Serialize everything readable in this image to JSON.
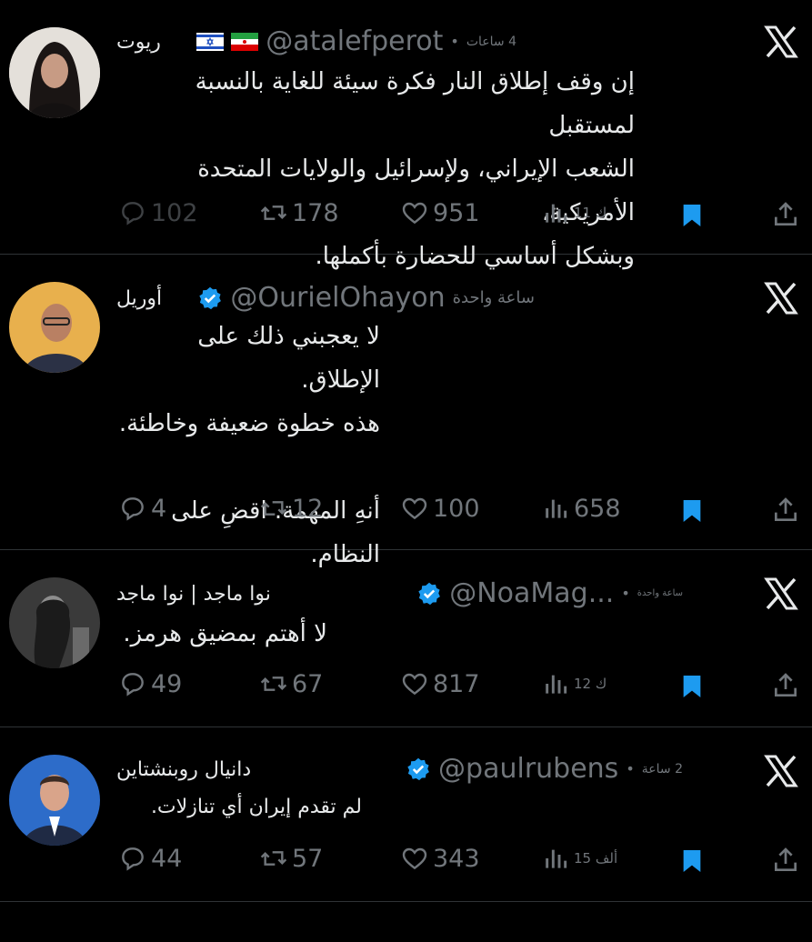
{
  "tweets": [
    {
      "name": "ريوت",
      "handle": "@atalefperot",
      "time": "4 ساعات",
      "flags": [
        "israel-flag",
        "iran-flag"
      ],
      "verified": false,
      "text": "إن وقف إطلاق النار فكرة سيئة للغاية بالنسبة لمستقبل\nالشعب الإيراني، ولإسرائيل والولايات المتحدة الأمريكية،\nوبشكل أساسي للحضارة بأكملها.",
      "replies": "102",
      "retweets": "178",
      "likes": "951",
      "views": "11 ك"
    },
    {
      "name": "أوريل",
      "handle": "@OurielOhayon",
      "time": "ساعة واحدة",
      "flags": [],
      "verified": true,
      "text": "لا يعجبني ذلك على الإطلاق.\nهذه خطوة ضعيفة وخاطئة.\n\nأنهِ المهمة. اقضِ على النظام.",
      "replies": "4",
      "retweets": "12",
      "likes": "100",
      "views": "658"
    },
    {
      "name": "نوا ماجد | نوا ماجد",
      "handle": "@NoaMag...",
      "time": "ساعة واحدة",
      "flags": [],
      "verified": true,
      "text": "لا أهتم بمضيق هرمز.",
      "replies": "49",
      "retweets": "67",
      "likes": "817",
      "views": "12 ك"
    },
    {
      "name": "دانيال روبنشتاين",
      "handle": "@paulrubens",
      "time": "2 ساعة",
      "flags": [],
      "verified": true,
      "text": "لم تقدم إيران أي تنازلات.",
      "replies": "44",
      "retweets": "57",
      "likes": "343",
      "views": "15 ألف"
    }
  ],
  "colors": {
    "background": "#000000",
    "text": "#e7e9ea",
    "muted": "#71767b",
    "accent": "#1d9bf0",
    "divider": "#2f3336"
  }
}
